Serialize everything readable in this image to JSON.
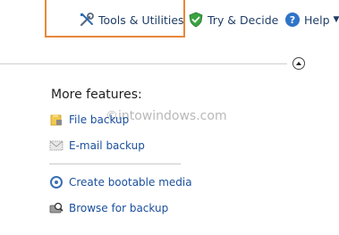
{
  "menu": {
    "tools_label": "Tools & Utilities",
    "try_label": "Try & Decide",
    "help_label": "Help"
  },
  "features": {
    "title": "More features:",
    "items": [
      {
        "label": "File backup",
        "icon": "folder-lock-icon"
      },
      {
        "label": "E-mail backup",
        "icon": "email-icon"
      },
      {
        "label": "Create bootable media",
        "icon": "refresh-media-icon"
      },
      {
        "label": "Browse for backup",
        "icon": "browse-disk-icon"
      }
    ]
  },
  "watermark": "©intowindows.com",
  "colors": {
    "highlight": "#e8873a",
    "link": "#1a4f9c",
    "menu_text": "#1f3d66"
  }
}
